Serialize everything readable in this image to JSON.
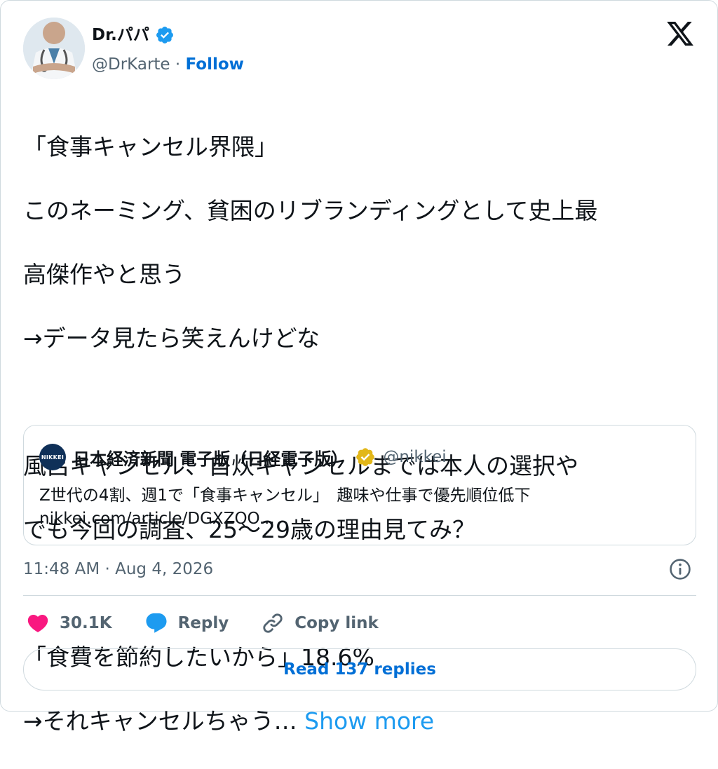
{
  "author": {
    "name": "Dr.パパ",
    "handle": "@DrKarte",
    "separator": "·",
    "follow_label": "Follow"
  },
  "tweet": {
    "lines": [
      "「食事キャンセル界隈」",
      "このネーミング、貧困のリブランディングとして史上最",
      "高傑作やと思う",
      "→データ見たら笑えんけどな",
      "",
      "風呂キャンセル、自炊キャンセルまでは本人の選択や",
      "でも今回の調査、25〜29歳の理由見てみ？",
      "",
      "「食費を節約したいから」18.6%"
    ],
    "last_line": "→それキャンセルちゃう…",
    "show_more": "Show more"
  },
  "quote": {
    "logo_text": "NIKKEI",
    "name": "日本経済新聞 電子版（日経電子版）",
    "handle": "@nikkei",
    "title": "Z世代の4割、週1で「食事キャンセル」　趣味や仕事で優先順位低下",
    "link": "nikkei.com/article/DGXZQO..."
  },
  "footer": {
    "timestamp": "11:48 AM · Aug 4, 2026",
    "like_count": "30.1K",
    "reply_label": "Reply",
    "copy_link_label": "Copy link",
    "read_replies": "Read 137 replies"
  },
  "colors": {
    "link_blue": "#006fd6",
    "show_more_blue": "#1d9bf0",
    "like_pink": "#f91880",
    "reply_blue": "#1d9bf0",
    "verified_blue": "#1d9bf0",
    "verified_gold": "#e2b719"
  },
  "icons": [
    "verified-badge-icon",
    "x-logo-icon",
    "info-icon",
    "heart-icon",
    "reply-bubble-icon",
    "link-icon",
    "gold-verified-badge-icon"
  ]
}
